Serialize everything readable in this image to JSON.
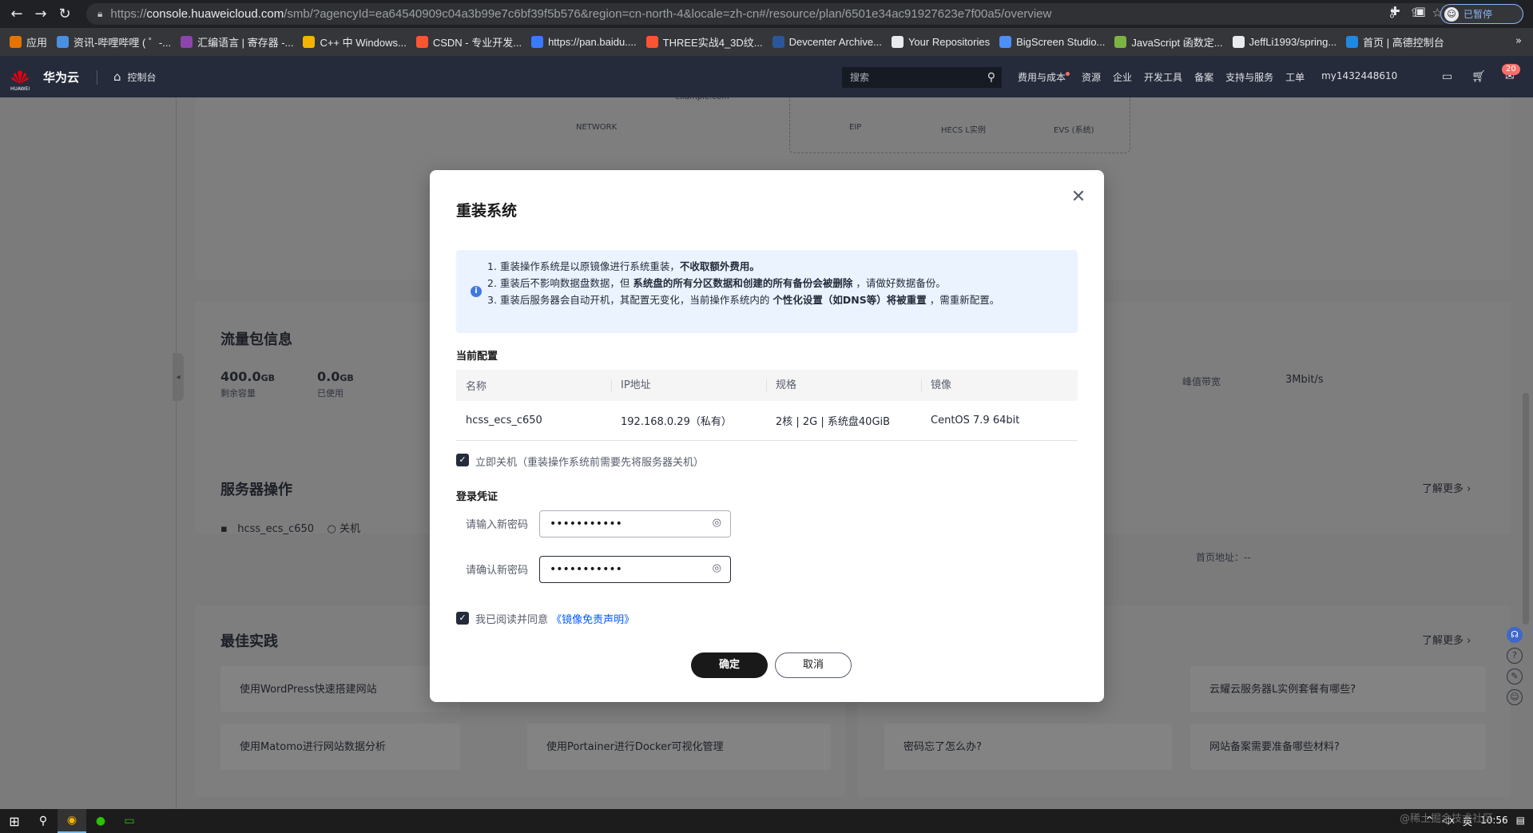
{
  "browser": {
    "url_scheme": "https://",
    "url_host": "console.huaweicloud.com",
    "url_path": "/smb/?agencyId=ea64540909c04a3b99e7c6bf39f5b576&region=cn-north-4&locale=zh-cn#/resource/plan/6501e34ac91927623e7f00a5/overview",
    "profile_status": "已暂停"
  },
  "bookmarks": [
    {
      "label": "应用",
      "color": "#e37400"
    },
    {
      "label": "资讯-哔哩哔哩 ( ゜-...",
      "color": "#4a90e2"
    },
    {
      "label": "汇编语言 | 寄存器 -...",
      "color": "#8e44ad"
    },
    {
      "label": "C++ 中 Windows...",
      "color": "#f2b400"
    },
    {
      "label": "CSDN - 专业开发...",
      "color": "#fc5531"
    },
    {
      "label": "https://pan.baidu....",
      "color": "#3a7bfd"
    },
    {
      "label": "THREE实战4_3D纹...",
      "color": "#fc5531"
    },
    {
      "label": "Devcenter Archive...",
      "color": "#2b579a"
    },
    {
      "label": "Your Repositories",
      "color": "#e8eaed"
    },
    {
      "label": "BigScreen Studio...",
      "color": "#4d8ef7"
    },
    {
      "label": "JavaScript 函数定...",
      "color": "#7cb342"
    },
    {
      "label": "JeffLi1993/spring...",
      "color": "#e8eaed"
    },
    {
      "label": "首页 | 高德控制台",
      "color": "#1e88e5"
    }
  ],
  "header": {
    "brand": "华为云",
    "logo_text": "HUAWEI",
    "console": "控制台",
    "search_placeholder": "搜索",
    "menu": [
      "费用与成本",
      "资源",
      "企业",
      "开发工具",
      "备案",
      "支持与服务",
      "工单",
      "my1432448610"
    ],
    "badge": "20"
  },
  "background": {
    "diagram": {
      "network": "NETWORK",
      "domain": "example.com",
      "eip": "EIP",
      "hecs": "HECS L实例",
      "evs": "EVS (系统)"
    },
    "traffic": {
      "title": "流量包信息",
      "remain_value": "400.0",
      "remain_unit": "GB",
      "remain_label": "剩余容量",
      "used_value": "0.0",
      "used_unit": "GB",
      "used_label": "已使用",
      "bandwidth_label": "峰值带宽",
      "bandwidth_value": "3Mbit/s"
    },
    "server_ops": {
      "title": "服务器操作",
      "server": "hcss_ecs_c650",
      "status": "关机",
      "more": "了解更多",
      "home_label": "首页地址：--"
    },
    "best": {
      "title": "最佳实践",
      "more": "了解更多",
      "items": [
        "使用WordPress快速搭建网站",
        "使用Matomo进行网站数据分析",
        "使用Portainer进行Docker可视化管理",
        "密码忘了怎么办?",
        "云耀云服务器L实例套餐有哪些?",
        "网站备案需要准备哪些材料?"
      ]
    }
  },
  "modal": {
    "title": "重装系统",
    "notice": [
      {
        "pre": "1. 重装操作系统是以原镜像进行系统重装，",
        "bold": "不收取额外费用。",
        "post": ""
      },
      {
        "pre": "2. 重装后不影响数据盘数据，但 ",
        "bold": "系统盘的所有分区数据和创建的所有备份会被删除",
        "post": " ，请做好数据备份。"
      },
      {
        "pre": "3. 重装后服务器会自动开机，其配置无变化，当前操作系统内的 ",
        "bold": "个性化设置（如DNS等）将被重置",
        "post": " ，需重新配置。"
      }
    ],
    "current_config_label": "当前配置",
    "table": {
      "headers": [
        "名称",
        "IP地址",
        "规格",
        "镜像"
      ],
      "row": [
        "hcss_ecs_c650",
        "192.168.0.29（私有）",
        "2核 | 2G | 系统盘40GiB",
        "CentOS 7.9 64bit"
      ]
    },
    "shutdown_checkbox": "立即关机（重装操作系统前需要先将服务器关机）",
    "credentials_label": "登录凭证",
    "new_password_label": "请输入新密码",
    "confirm_password_label": "请确认新密码",
    "new_password_value": "•••••••••••",
    "confirm_password_value": "•••••••••••",
    "agree_text": "我已阅读并同意",
    "agree_link": "《镜像免责声明》",
    "ok": "确定",
    "cancel": "取消"
  },
  "taskbar": {
    "lang": "英",
    "time": "10:56"
  },
  "watermark": "@稀土掘金技术社区"
}
